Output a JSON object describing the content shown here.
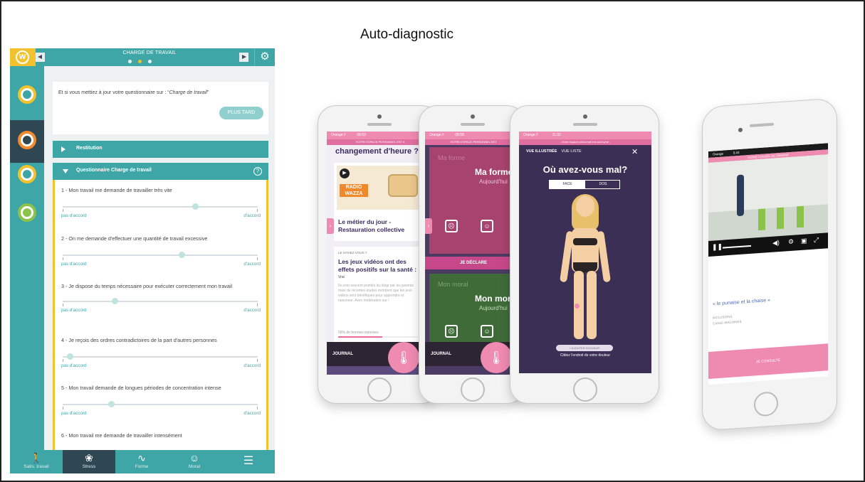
{
  "slide": {
    "title": "Auto-diagnostic"
  },
  "tablet": {
    "header": {
      "title": "CHARGE DE TRAVAIL",
      "logo": "W"
    },
    "prompt": {
      "text_prefix": "Et si vous mettiez à jour votre questionnaire sur : “",
      "text_topic": "Charge de travail",
      "text_suffix": "”",
      "later_button": "PLUS TARD"
    },
    "sections": {
      "restitution": "Restitution",
      "questionnaire": "Questionnaire Charge de travail"
    },
    "questions": [
      {
        "text": "1 - Mon travail me demande de travailler très vite",
        "left": "pas d'accord",
        "right": "d'accord",
        "value": 0.68
      },
      {
        "text": "2 - On me demande d'effectuer une quantité de travail excessive",
        "left": "pas d'accord",
        "right": "d'accord",
        "value": 0.61
      },
      {
        "text": "3 - Je dispose du temps nécessaire pour exécuter correctement mon travail",
        "left": "pas d'accord",
        "right": "d'accord",
        "value": 0.27
      },
      {
        "text": "4 - Je reçois des ordres contradictoires de la part d'autres personnes",
        "left": "pas d'accord",
        "right": "d'accord",
        "value": 0.04
      },
      {
        "text": "5 - Mon travail demande de longues périodes de concentration intense",
        "left": "pas d'accord",
        "right": "d'accord",
        "value": 0.25
      },
      {
        "text": "6 - Mon travail me demande de travailler intensément",
        "left": "",
        "right": ""
      }
    ],
    "tabs": [
      {
        "label": "Satis. travail",
        "icon": "person-icon"
      },
      {
        "label": "Stress",
        "icon": "lotus-icon"
      },
      {
        "label": "Forme",
        "icon": "pulse-icon"
      },
      {
        "label": "Moral",
        "icon": "smiley-icon"
      },
      {
        "label": "",
        "icon": "menu-icon"
      }
    ]
  },
  "phone1": {
    "status": "Orange F",
    "time": "08:53",
    "banner": "VOTRE ESPACE PERSONNEL EST A",
    "headline": "changement d'heure ?",
    "radio_logo": "RADIO WAZZA",
    "metier": "Le métier du jour - Restauration collective",
    "tag": "LE SAVIEZ-VOUS ?",
    "jeux_title": "Les jeux vidéos ont des effets positifs sur la santé :",
    "vrai": "Vrai",
    "jeux_body": "Ils sont souvent pointés du doigt par les parents mais de récentes études montrent que les jeux vidéos sont bénéfiques pour apprendre et raisonner. Avec modération sur !",
    "stat": "56% de bonnes réponses",
    "tab_journal": "JOURNAL"
  },
  "phone2": {
    "status": "Orange F",
    "time": "08:58",
    "banner": "VOTRE ESPACE PERSONNEL EST",
    "faint_top": "Ma forme",
    "mood1": "Ma forme",
    "mood1_sub": "Aujourd'hui",
    "declare": "JE DÉCLARE",
    "faint_bottom": "Mon moral",
    "mood2": "Mon moral",
    "mood2_sub": "Aujourd'hui",
    "tab_journal": "JOURNAL"
  },
  "phone3": {
    "status": "Orange F",
    "time": "11:32",
    "banner": "- Votre espace personnel est anonyme -",
    "tab1": "VUE ILLUSTRÉE",
    "tab2": "VUE LISTE",
    "title": "Où avez-vous mal?",
    "face": "FACE",
    "dos": "DOS",
    "add": "+ AJOUTER DOULEUR",
    "cible": "Ciblez l'endroit de votre douleur"
  },
  "phone4": {
    "status": "Orange",
    "time": "5:43",
    "banner": "VOTRE CONSEIL DE SEMAINE",
    "quote": "« le punaise et la chaise »",
    "sub1": "INCLUSIONS",
    "sub2": "CASSE-MACHINES",
    "bottom": "JE CONSULTE"
  }
}
